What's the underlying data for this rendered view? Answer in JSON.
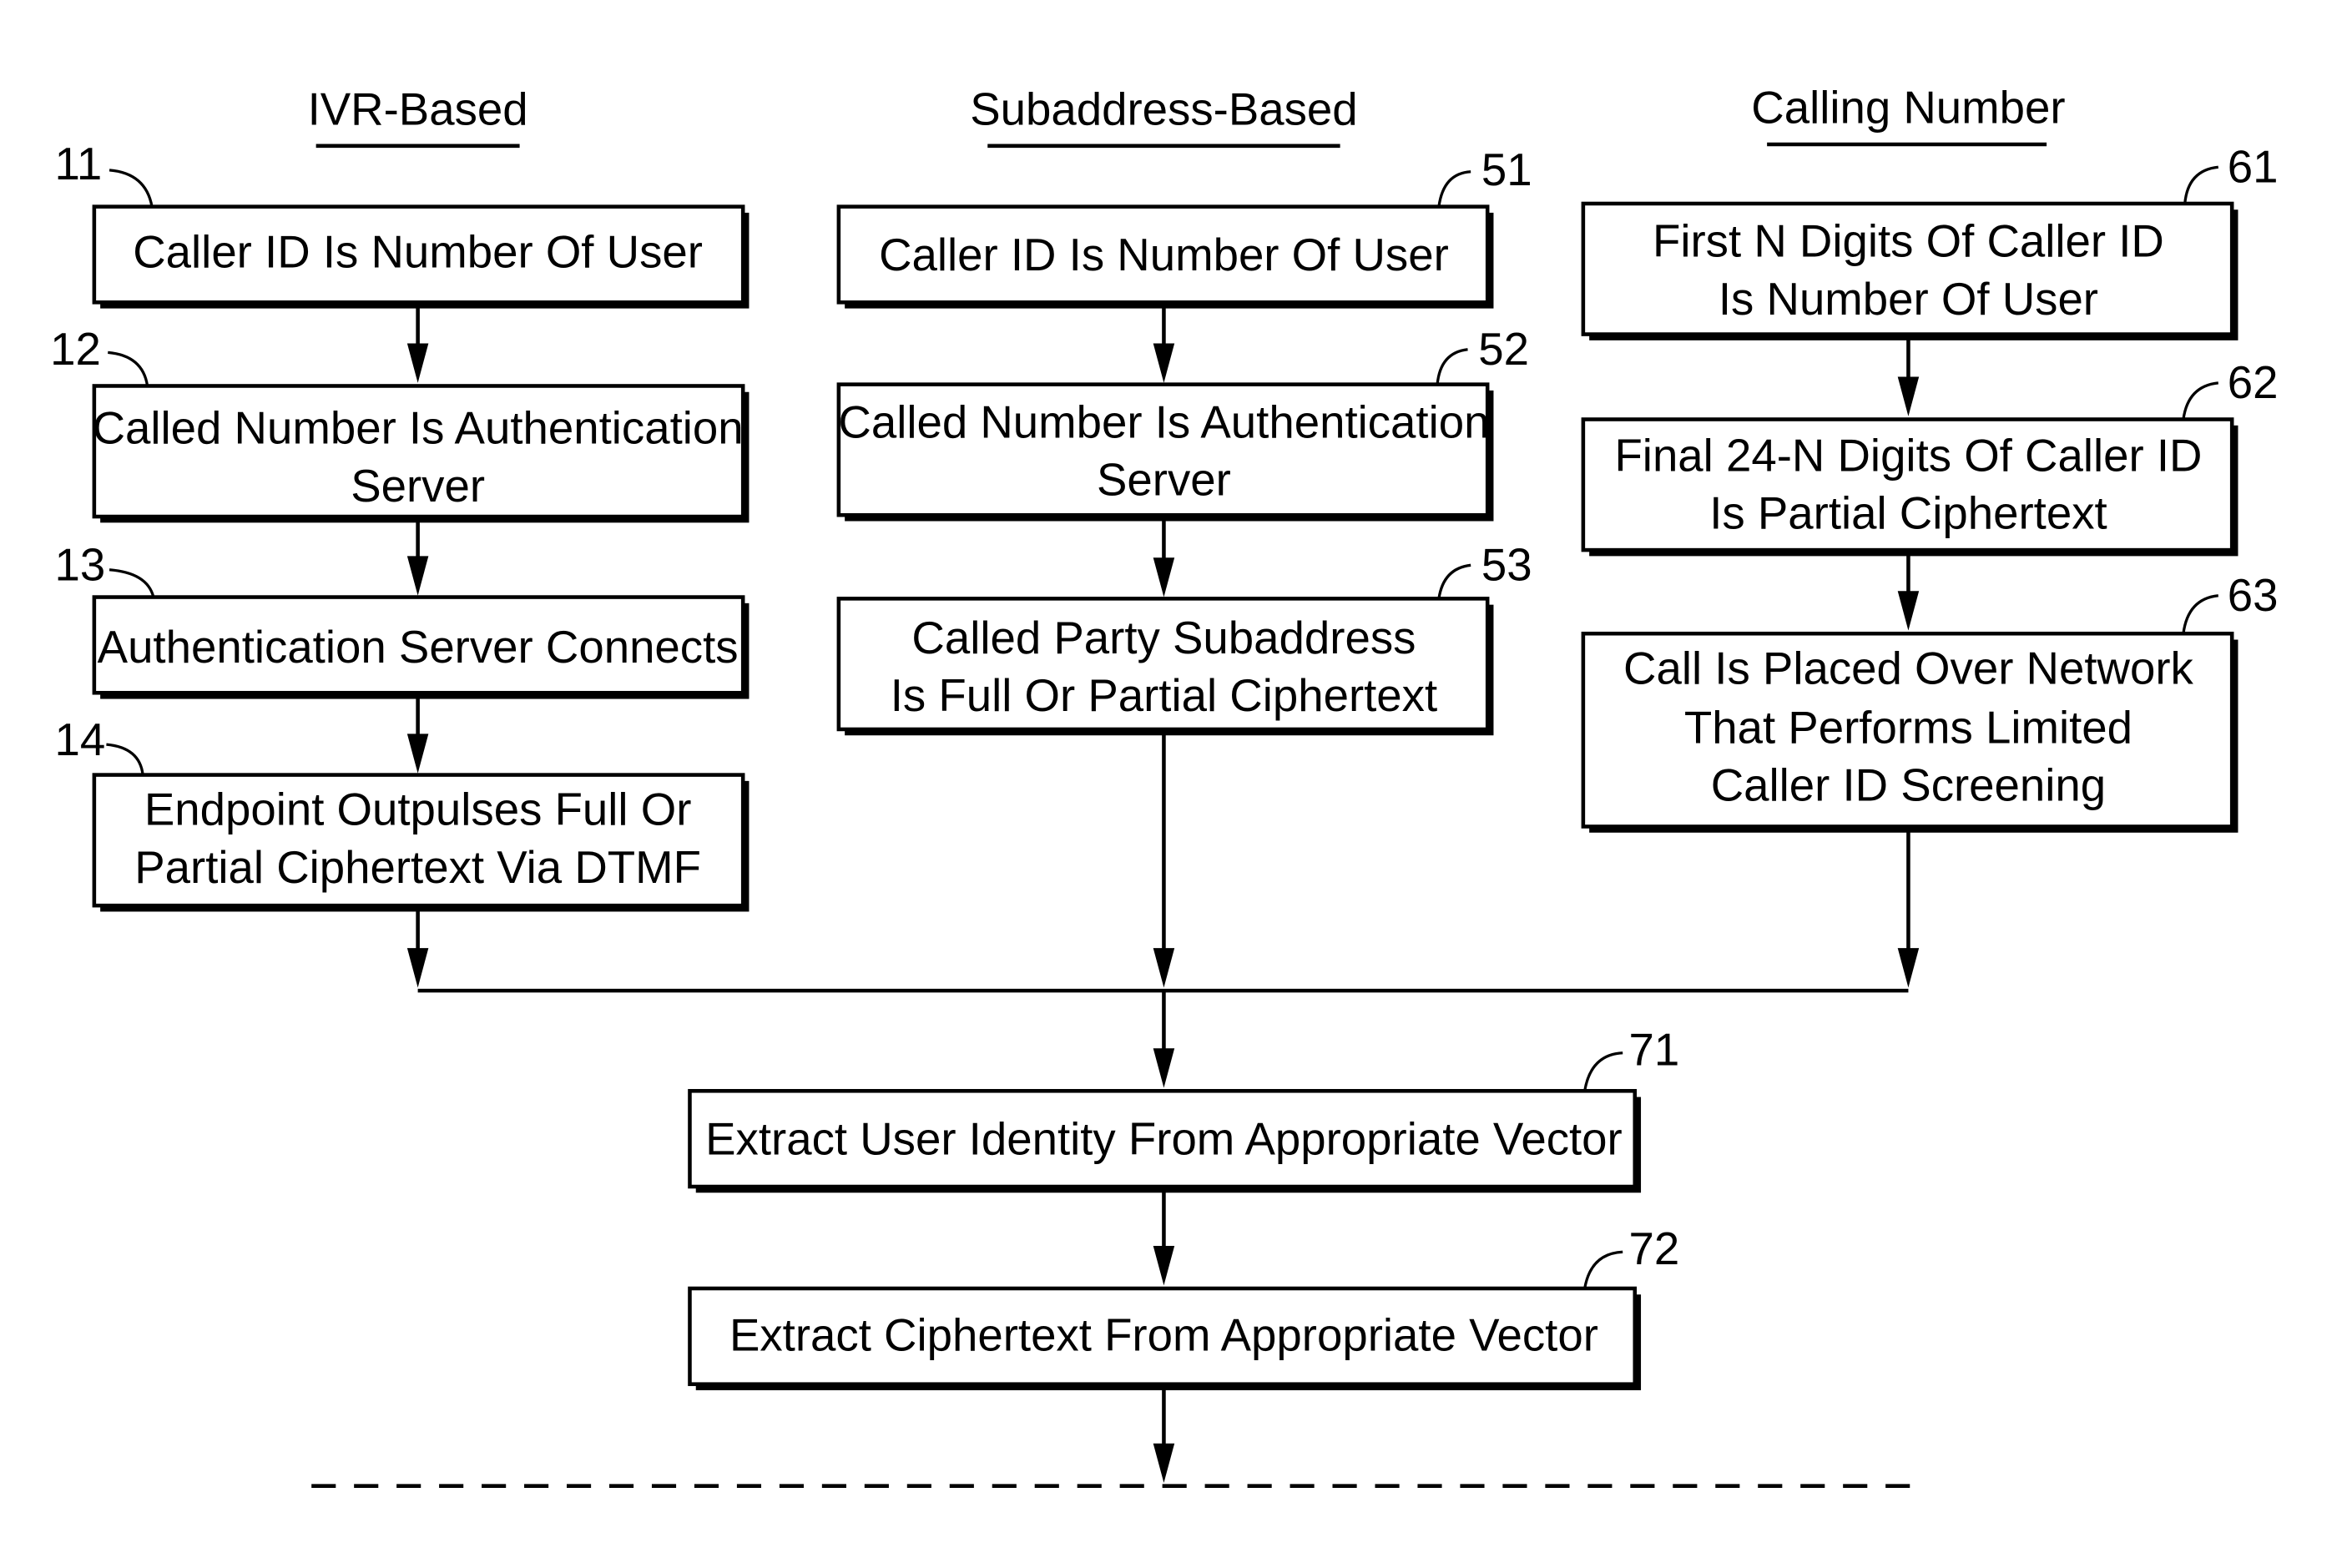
{
  "columns": [
    {
      "id": "ivr",
      "title": "IVR-Based",
      "steps": [
        {
          "ref": "11",
          "lines": [
            "Caller ID Is Number Of User"
          ]
        },
        {
          "ref": "12",
          "lines": [
            "Called Number Is Authentication",
            "Server"
          ]
        },
        {
          "ref": "13",
          "lines": [
            "Authentication Server Connects"
          ]
        },
        {
          "ref": "14",
          "lines": [
            "Endpoint Outpulses Full Or",
            "Partial Ciphertext Via DTMF"
          ]
        }
      ]
    },
    {
      "id": "subaddress",
      "title": "Subaddress-Based",
      "steps": [
        {
          "ref": "51",
          "lines": [
            "Caller ID Is Number Of User"
          ]
        },
        {
          "ref": "52",
          "lines": [
            "Called Number Is Authentication",
            "Server"
          ]
        },
        {
          "ref": "53",
          "lines": [
            "Called Party Subaddress",
            "Is Full Or Partial Ciphertext"
          ]
        }
      ]
    },
    {
      "id": "calling",
      "title": "Calling Number",
      "steps": [
        {
          "ref": "61",
          "lines": [
            "First N Digits Of Caller ID",
            "Is Number Of User"
          ]
        },
        {
          "ref": "62",
          "lines": [
            "Final 24-N Digits Of Caller ID",
            "Is Partial Ciphertext"
          ]
        },
        {
          "ref": "63",
          "lines": [
            "Call Is Placed Over Network",
            "That Performs Limited",
            "Caller ID Screening"
          ]
        }
      ]
    }
  ],
  "common_steps": [
    {
      "ref": "71",
      "lines": [
        "Extract User Identity From Appropriate Vector"
      ]
    },
    {
      "ref": "72",
      "lines": [
        "Extract Ciphertext From Appropriate Vector"
      ]
    }
  ]
}
